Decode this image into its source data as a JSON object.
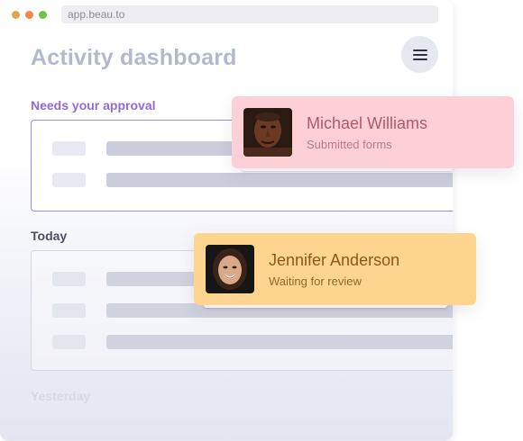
{
  "browser": {
    "url": "app.beau.to"
  },
  "page": {
    "title": "Activity dashboard"
  },
  "sections": {
    "approval_label": "Needs your approval",
    "today_label": "Today",
    "yesterday_label": "Yesterday"
  },
  "notifications": [
    {
      "name": "Michael Williams",
      "status": "Submitted forms",
      "color": "#fdd0d8"
    },
    {
      "name": "Jennifer Anderson",
      "status": "Waiting for review",
      "color": "#fdd58e"
    }
  ],
  "icons": {
    "menu": "hamburger-menu-icon"
  }
}
